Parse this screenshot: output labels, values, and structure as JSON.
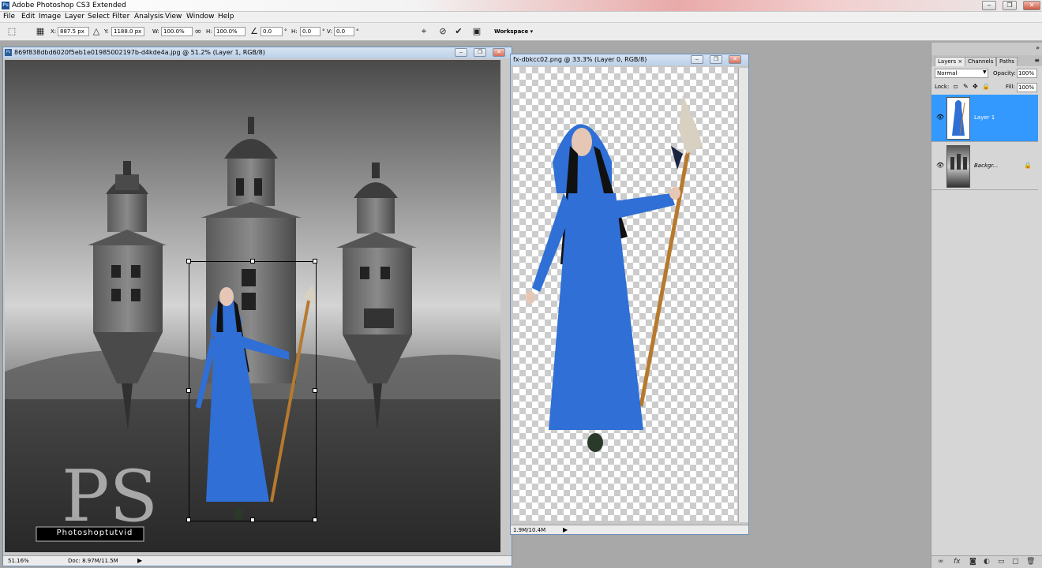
{
  "app": {
    "title": "Adobe Photoshop CS3 Extended",
    "logo": "Ps"
  },
  "menu": [
    "File",
    "Edit",
    "Image",
    "Layer",
    "Select",
    "Filter",
    "Analysis",
    "View",
    "Window",
    "Help"
  ],
  "options": {
    "x_label": "X:",
    "x_value": "887.5 px",
    "y_label": "Y:",
    "y_value": "1188.0 px",
    "w_label": "W:",
    "w_value": "100.0%",
    "h_label": "H:",
    "h_value": "100.0%",
    "angle_value": "0.0",
    "degree": "°",
    "hskew_label": "H:",
    "hskew_value": "0.0",
    "vskew_label": "V:",
    "vskew_value": "0.0",
    "workspace_label": "Workspace ▾"
  },
  "doc1": {
    "title": "869f838dbd6020f5eb1e01985002197b-d4kde4a.jpg @ 51.2% (Layer 1, RGB/8)",
    "zoom": "51.16%",
    "doc_size": "Doc: 8.97M/11.5M",
    "watermark_logo": "PS",
    "watermark_text": "Photoshoptutvid"
  },
  "doc2": {
    "title": "fx-dbkcc02.png @ 33.3% (Layer 0, RGB/8)",
    "doc_size": "1.9M/10.4M"
  },
  "panel": {
    "tabs": [
      "Layers ×",
      "Channels",
      "Paths"
    ],
    "blend_mode": "Normal",
    "opacity_label": "Opacity:",
    "opacity_value": "100%",
    "lock_label": "Lock:",
    "fill_label": "Fill:",
    "fill_value": "100%",
    "layers": [
      {
        "name": "Layer 1",
        "selected": true
      },
      {
        "name": "Backgr...",
        "selected": false
      }
    ]
  },
  "colors": {
    "selection": "#3399ff",
    "dress": "#2f6fd6"
  }
}
